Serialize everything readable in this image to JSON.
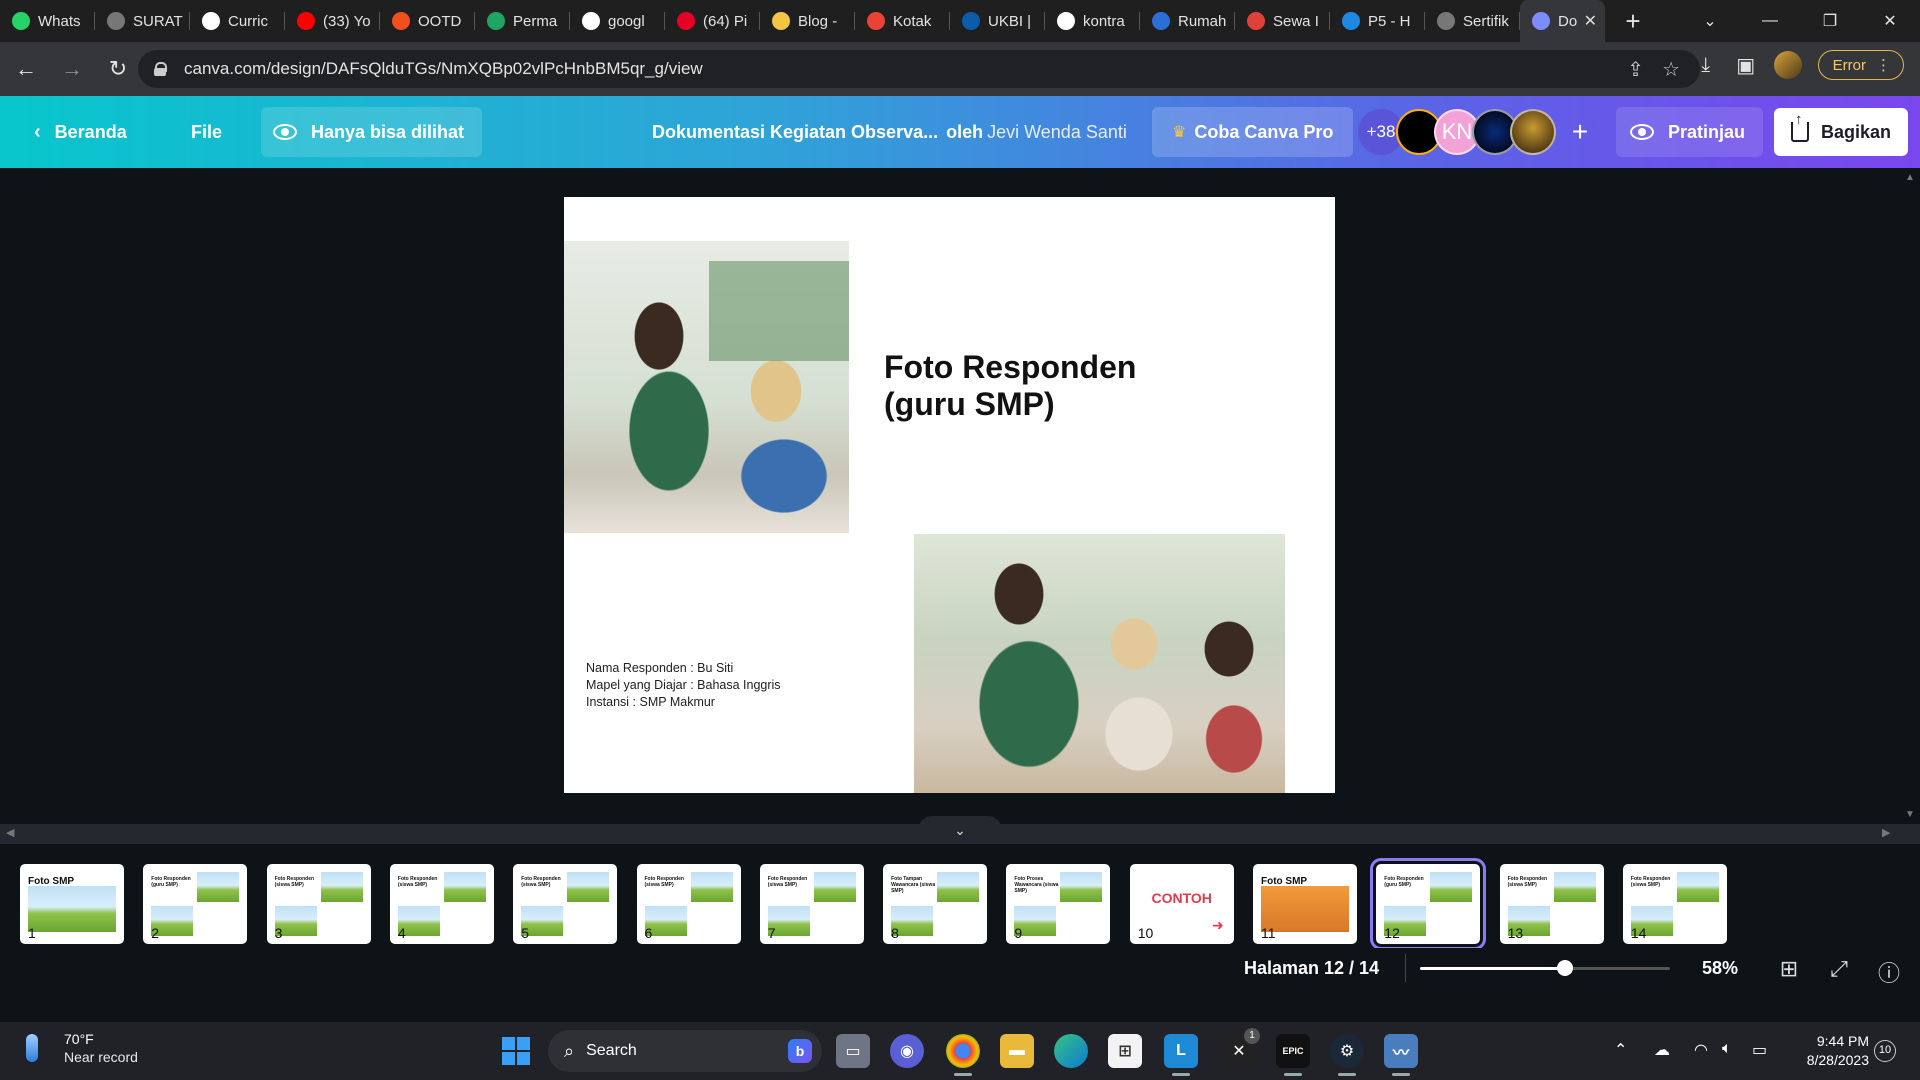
{
  "browser": {
    "tabs": [
      {
        "label": "Whats",
        "icon": "whatsapp-icon",
        "color": "#25d366"
      },
      {
        "label": "SURAT",
        "icon": "globe-icon",
        "color": "#777777"
      },
      {
        "label": "Curric",
        "icon": "drive-triangle-icon",
        "color": "#ffffff"
      },
      {
        "label": "(33) Yo",
        "icon": "youtube-icon",
        "color": "#ff0000"
      },
      {
        "label": "OOTD",
        "icon": "figma-icon",
        "color": "#f24e1e"
      },
      {
        "label": "Perma",
        "icon": "google-drive-icon",
        "color": "#1fa463"
      },
      {
        "label": "googl",
        "icon": "google-icon",
        "color": "#ffffff"
      },
      {
        "label": "(64) Pi",
        "icon": "pinterest-icon",
        "color": "#e60023"
      },
      {
        "label": "Blog -",
        "icon": "blog-icon",
        "color": "#f4c542"
      },
      {
        "label": "Kotak",
        "icon": "gmail-icon",
        "color": "#ea4335"
      },
      {
        "label": "UKBI |",
        "icon": "ukbi-icon",
        "color": "#0b5cad"
      },
      {
        "label": "kontra",
        "icon": "google-icon",
        "color": "#ffffff"
      },
      {
        "label": "Rumah",
        "icon": "rumah-icon",
        "color": "#2a6fd6"
      },
      {
        "label": "Sewa I",
        "icon": "sewa-icon",
        "color": "#e0403a"
      },
      {
        "label": "P5 - H",
        "icon": "canva-icon",
        "color": "#1e88e5"
      },
      {
        "label": "Sertifik",
        "icon": "globe-icon",
        "color": "#777777"
      },
      {
        "label": "Do",
        "icon": "canva-doc-icon",
        "color": "#7b8cff"
      }
    ],
    "url": "canva.com/design/DAFsQlduTGs/NmXQBp02vlPcHnbBM5qr_g/view",
    "profile_status": "Error"
  },
  "canva": {
    "home_label": "Beranda",
    "file_label": "File",
    "view_only_label": "Hanya bisa dilihat",
    "doc_title": "Dokumentasi Kegiatan Observa...",
    "by_label": "oleh",
    "owner": "Jevi Wenda Santi",
    "pro_label": "Coba Canva Pro",
    "collab_count": "+38",
    "collab_initials": "KN",
    "preview_label": "Pratinjau",
    "share_label": "Bagikan"
  },
  "slide": {
    "title": "Foto Responden (guru SMP)",
    "info_lines": [
      "Nama Responden : Bu Siti",
      "Mapel yang Diajar : Bahasa Inggris",
      "Instansi : SMP Makmur"
    ]
  },
  "thumbnails": [
    {
      "num": "1",
      "title": "Foto SMP"
    },
    {
      "num": "2",
      "title": "Foto Responden (guru SMP)"
    },
    {
      "num": "3",
      "title": "Foto Responden (siswa SMP)"
    },
    {
      "num": "4",
      "title": "Foto Responden (siswa SMP)"
    },
    {
      "num": "5",
      "title": "Foto Responden (siswa SMP)"
    },
    {
      "num": "6",
      "title": "Foto Responden (siswa SMP)"
    },
    {
      "num": "7",
      "title": "Foto Responden (siswa SMP)"
    },
    {
      "num": "8",
      "title": "Foto Tampan Wawancara (siswa SMP)"
    },
    {
      "num": "9",
      "title": "Foto Proses Wawancara (siswa SMP)"
    },
    {
      "num": "10",
      "title": "CONTOH"
    },
    {
      "num": "11",
      "title": "Foto SMP"
    },
    {
      "num": "12",
      "title": "Foto Responden (guru SMP)"
    },
    {
      "num": "13",
      "title": "Foto Responden (siswa SMP)"
    },
    {
      "num": "14",
      "title": "Foto Responden (siswa SMP)"
    }
  ],
  "footer": {
    "page_label": "Halaman 12 / 14",
    "zoom_label": "58%",
    "zoom_fraction": 0.58
  },
  "taskbar": {
    "temperature": "70°F",
    "weather": "Near record",
    "search_label": "Search",
    "time": "9:44 PM",
    "date": "8/28/2023",
    "notifications": "10",
    "badge": "1"
  }
}
